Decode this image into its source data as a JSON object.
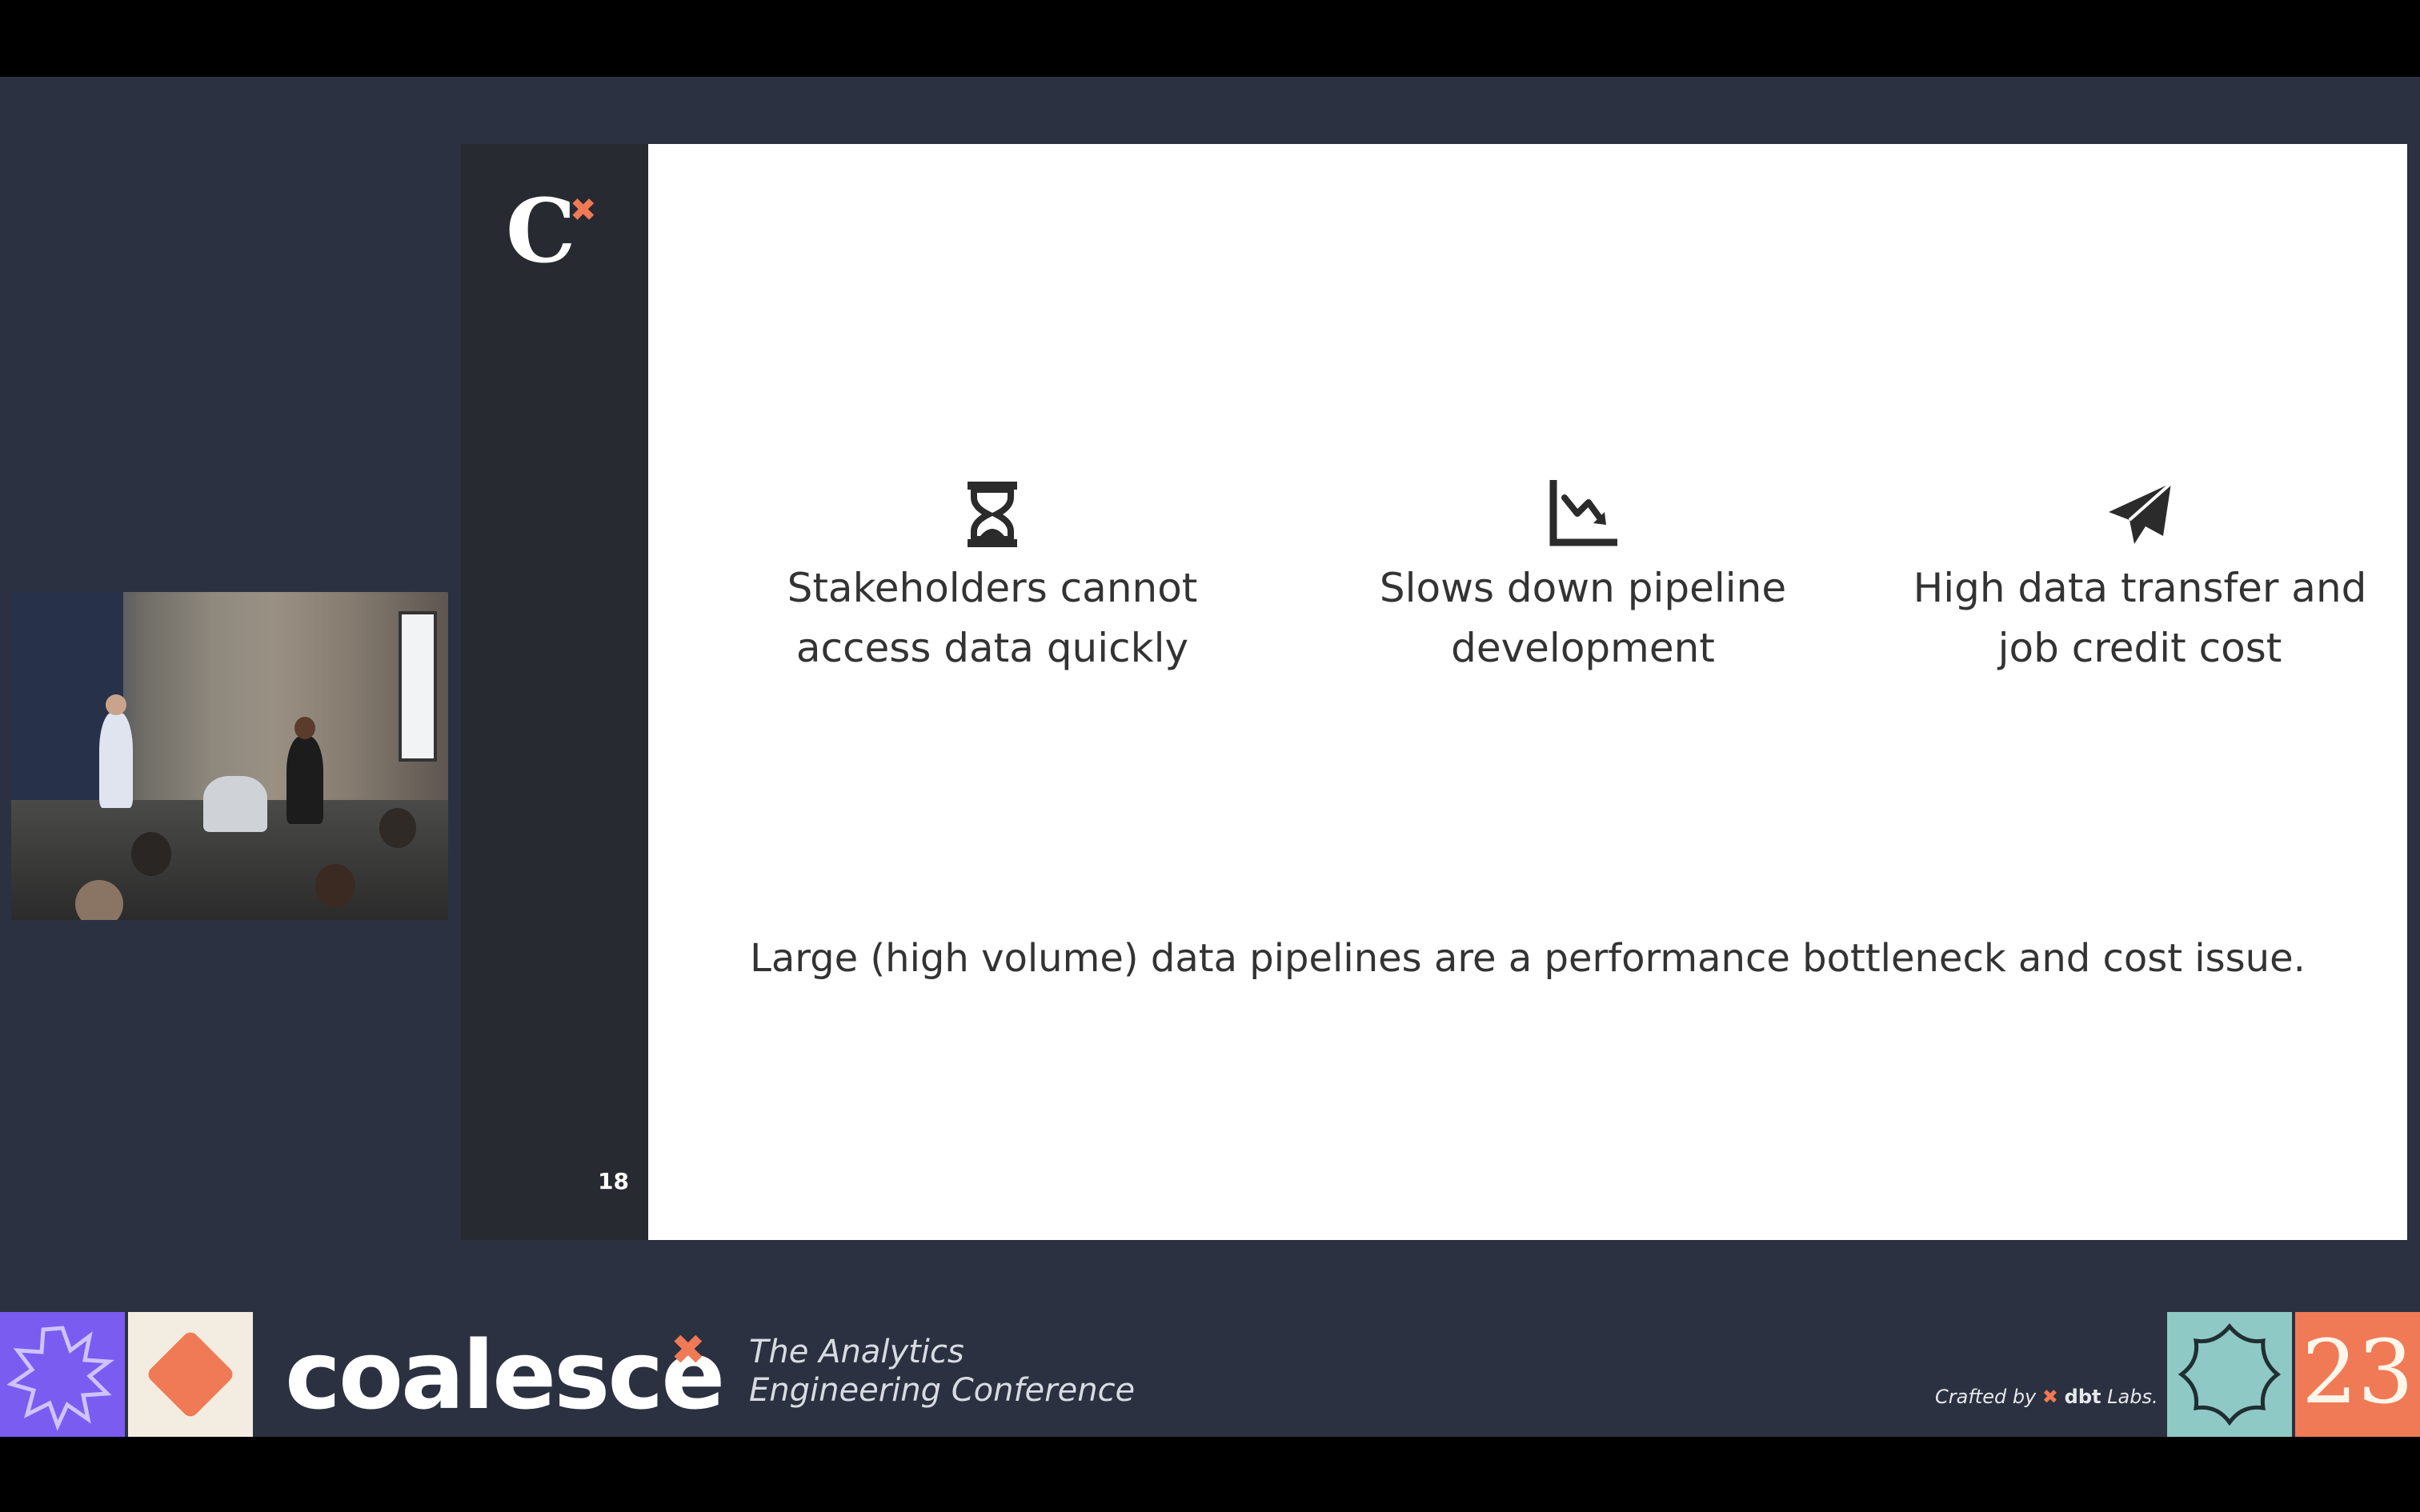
{
  "slide": {
    "page_number": "18",
    "points": [
      {
        "icon": "hourglass-icon",
        "line1": "Stakeholders cannot",
        "line2": "access data quickly"
      },
      {
        "icon": "chart-down-icon",
        "line1": "Slows down pipeline",
        "line2": "development"
      },
      {
        "icon": "paper-plane-icon",
        "line1": "High data transfer and",
        "line2": "job credit cost"
      }
    ],
    "summary": "Large (high volume) data pipelines are a performance bottleneck and cost issue."
  },
  "branding": {
    "name": "coalesce",
    "tagline_line1": "The Analytics",
    "tagline_line2": "Engineering Conference",
    "crafted_by": "Crafted by",
    "company": "dbt",
    "company_suffix": "Labs.",
    "year": "23",
    "colors": {
      "accent": "#ef7a55",
      "purple": "#7b5cf0",
      "teal": "#8fc9c5",
      "cream": "#f3ece0",
      "background": "#2b3140"
    }
  }
}
